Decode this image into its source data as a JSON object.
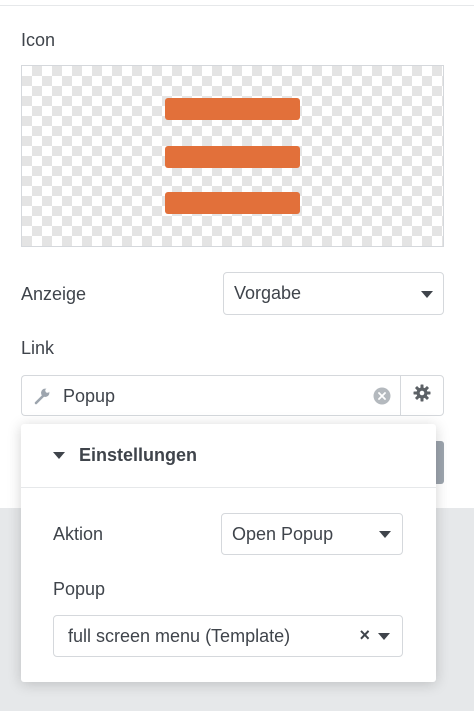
{
  "icon_section": {
    "label": "Icon",
    "preview_icon": "hamburger-menu-icon",
    "icon_color": "#e2703a"
  },
  "display": {
    "label": "Anzeige",
    "value": "Vorgabe"
  },
  "link": {
    "label": "Link",
    "value": "Popup",
    "leading_icon": "wrench-icon",
    "clear_icon": "clear-icon",
    "settings_icon": "gear-icon"
  },
  "settings_popover": {
    "title": "Einstellungen",
    "action": {
      "label": "Aktion",
      "value": "Open Popup"
    },
    "popup": {
      "label": "Popup",
      "value": "full screen menu (Template)",
      "remove_glyph": "×"
    }
  }
}
